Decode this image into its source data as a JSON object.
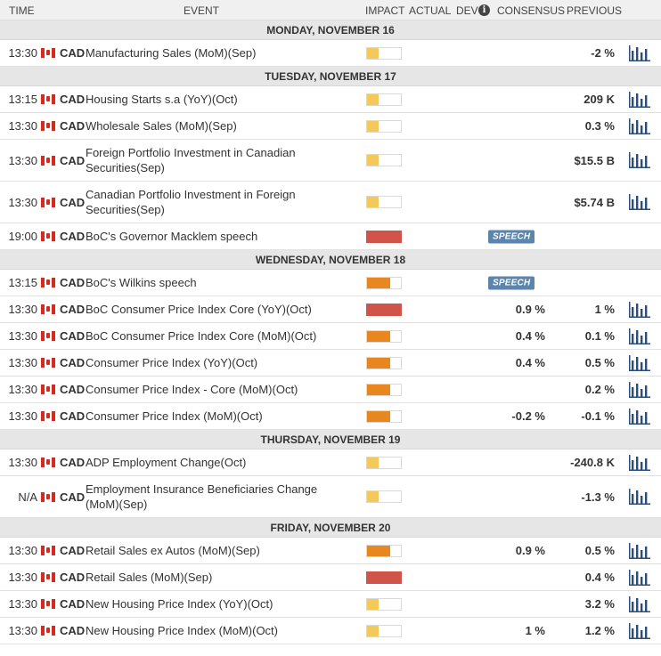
{
  "columns": {
    "time": "TIME",
    "event": "EVENT",
    "impact": "IMPACT",
    "actual": "ACTUAL",
    "dev": "DEV",
    "dev_info_icon": "i",
    "consensus": "CONSENSUS",
    "previous": "PREVIOUS"
  },
  "colors": {
    "impact_low": "#f3c95a",
    "impact_medium": "#e8861f",
    "impact_high": "#d0544a",
    "speech_badge": "#5b85ad",
    "chart_icon": "#2b4f7a"
  },
  "days": [
    {
      "label": "MONDAY, NOVEMBER 16",
      "events": [
        {
          "time": "13:30",
          "currency": "CAD",
          "name": "Manufacturing Sales (MoM)(Sep)",
          "impact": "low",
          "actual": "",
          "consensus": "",
          "previous": "-2 %",
          "chart": true
        }
      ]
    },
    {
      "label": "TUESDAY, NOVEMBER 17",
      "events": [
        {
          "time": "13:15",
          "currency": "CAD",
          "name": "Housing Starts s.a (YoY)(Oct)",
          "impact": "low",
          "actual": "",
          "consensus": "",
          "previous": "209 K",
          "chart": true
        },
        {
          "time": "13:30",
          "currency": "CAD",
          "name": "Wholesale Sales (MoM)(Sep)",
          "impact": "low",
          "actual": "",
          "consensus": "",
          "previous": "0.3 %",
          "chart": true
        },
        {
          "time": "13:30",
          "currency": "CAD",
          "name": "Foreign Portfolio Investment in Canadian Securities(Sep)",
          "impact": "low",
          "actual": "",
          "consensus": "",
          "previous": "$15.5 B",
          "chart": true,
          "tall": true
        },
        {
          "time": "13:30",
          "currency": "CAD",
          "name": "Canadian Portfolio Investment in Foreign Securities(Sep)",
          "impact": "low",
          "actual": "",
          "consensus": "",
          "previous": "$5.74 B",
          "chart": true,
          "tall": true
        },
        {
          "time": "19:00",
          "currency": "CAD",
          "name": "BoC's Governor Macklem speech",
          "impact": "high",
          "actual": "",
          "consensus": "",
          "previous": "",
          "chart": false,
          "badge": "SPEECH"
        }
      ]
    },
    {
      "label": "WEDNESDAY, NOVEMBER 18",
      "events": [
        {
          "time": "13:15",
          "currency": "CAD",
          "name": "BoC's Wilkins speech",
          "impact": "medium",
          "actual": "",
          "consensus": "",
          "previous": "",
          "chart": false,
          "badge": "SPEECH"
        },
        {
          "time": "13:30",
          "currency": "CAD",
          "name": "BoC Consumer Price Index Core (YoY)(Oct)",
          "impact": "high",
          "actual": "",
          "consensus": "0.9 %",
          "previous": "1 %",
          "chart": true
        },
        {
          "time": "13:30",
          "currency": "CAD",
          "name": "BoC Consumer Price Index Core (MoM)(Oct)",
          "impact": "medium",
          "actual": "",
          "consensus": "0.4 %",
          "previous": "0.1 %",
          "chart": true
        },
        {
          "time": "13:30",
          "currency": "CAD",
          "name": "Consumer Price Index (YoY)(Oct)",
          "impact": "medium",
          "actual": "",
          "consensus": "0.4 %",
          "previous": "0.5 %",
          "chart": true
        },
        {
          "time": "13:30",
          "currency": "CAD",
          "name": "Consumer Price Index - Core (MoM)(Oct)",
          "impact": "medium",
          "actual": "",
          "consensus": "",
          "previous": "0.2 %",
          "chart": true
        },
        {
          "time": "13:30",
          "currency": "CAD",
          "name": "Consumer Price Index (MoM)(Oct)",
          "impact": "medium",
          "actual": "",
          "consensus": "-0.2 %",
          "previous": "-0.1 %",
          "chart": true
        }
      ]
    },
    {
      "label": "THURSDAY, NOVEMBER 19",
      "events": [
        {
          "time": "13:30",
          "currency": "CAD",
          "name": "ADP Employment Change(Oct)",
          "impact": "low",
          "actual": "",
          "consensus": "",
          "previous": "-240.8 K",
          "chart": true
        },
        {
          "time": "N/A",
          "currency": "CAD",
          "name": "Employment Insurance Beneficiaries Change (MoM)(Sep)",
          "impact": "low",
          "actual": "",
          "consensus": "",
          "previous": "-1.3 %",
          "chart": true,
          "tall": true
        }
      ]
    },
    {
      "label": "FRIDAY, NOVEMBER 20",
      "events": [
        {
          "time": "13:30",
          "currency": "CAD",
          "name": "Retail Sales ex Autos (MoM)(Sep)",
          "impact": "medium",
          "actual": "",
          "consensus": "0.9 %",
          "previous": "0.5 %",
          "chart": true
        },
        {
          "time": "13:30",
          "currency": "CAD",
          "name": "Retail Sales (MoM)(Sep)",
          "impact": "high",
          "actual": "",
          "consensus": "",
          "previous": "0.4 %",
          "chart": true
        },
        {
          "time": "13:30",
          "currency": "CAD",
          "name": "New Housing Price Index (YoY)(Oct)",
          "impact": "low",
          "actual": "",
          "consensus": "",
          "previous": "3.2 %",
          "chart": true
        },
        {
          "time": "13:30",
          "currency": "CAD",
          "name": "New Housing Price Index (MoM)(Oct)",
          "impact": "low",
          "actual": "",
          "consensus": "1 %",
          "previous": "1.2 %",
          "chart": true
        }
      ]
    }
  ]
}
